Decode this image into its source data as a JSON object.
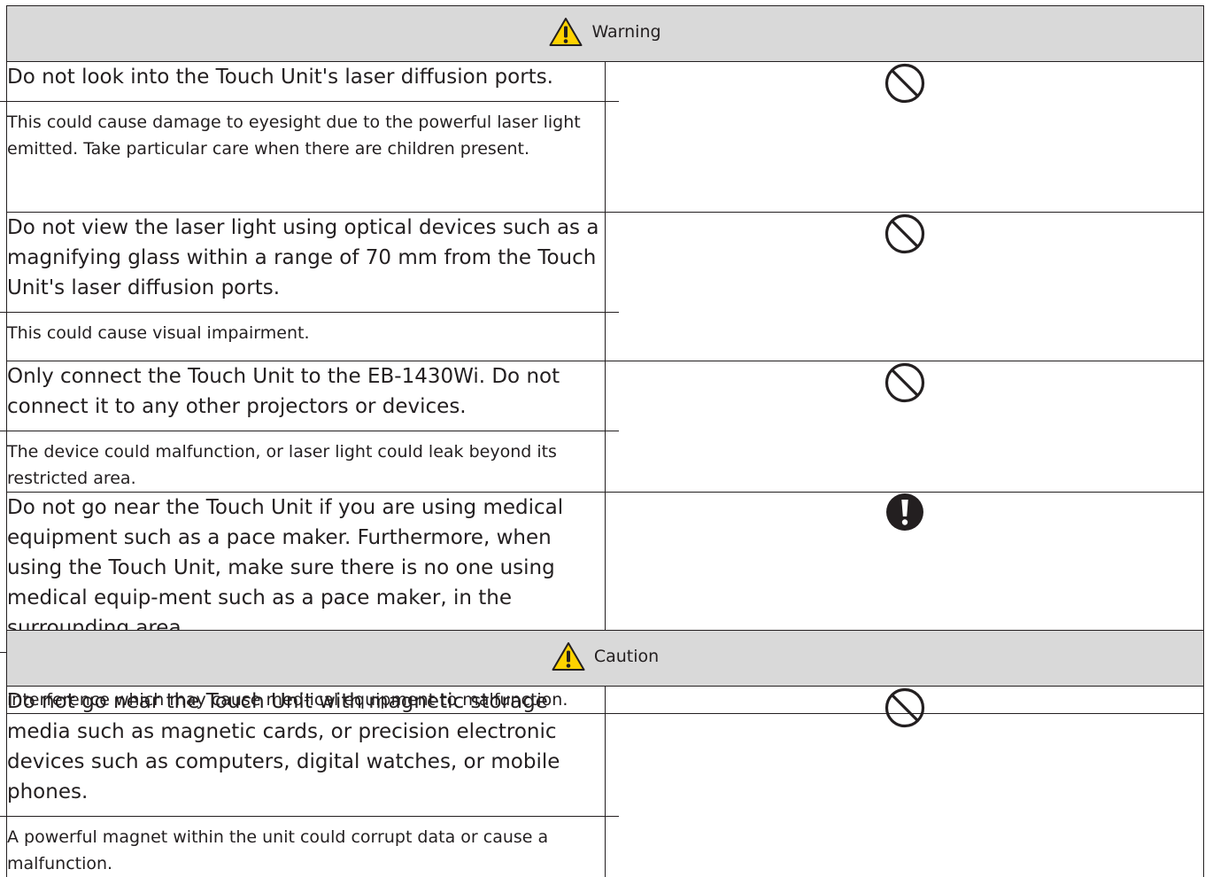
{
  "warning": {
    "title": "Warning",
    "rows": [
      {
        "instruction": "Do not look into the Touch Unit's laser diffusion ports.",
        "explanation": "This could cause damage to eyesight due to the powerful laser light emitted. Take particular care when there are children present.",
        "icon": "prohibition-icon"
      },
      {
        "instruction": "Do not view the laser light using optical devices such as a magnifying glass within a range of 70 mm from the Touch Unit's laser diffusion ports.",
        "explanation": "This could cause visual impairment.",
        "icon": "prohibition-icon"
      },
      {
        "instruction": "Only connect the Touch Unit to the EB-1430Wi. Do not connect it to any other projectors or devices.",
        "explanation": "The device could malfunction, or laser light could leak beyond its restricted area.",
        "icon": "prohibition-icon"
      },
      {
        "instruction": "Do not go near the Touch Unit if you are using medical equipment such as a pace maker. Furthermore, when using the Touch Unit, make sure there is no one using medical equip-ment such as a pace maker, in the surrounding area.",
        "explanation": "A powerful magnet within the unit generates electromagnetic interference which may cause med-ical equipment to malfunction.",
        "icon": "mandatory-action-icon"
      }
    ]
  },
  "caution": {
    "title": "Caution",
    "rows": [
      {
        "instruction": "Do not go near the Touch Unit with magnetic storage media such as magnetic cards, or precision electronic devices such as computers, digital watches, or mobile phones.",
        "explanation": "A powerful magnet within the unit could corrupt data or cause a malfunction.",
        "icon": "prohibition-icon"
      }
    ]
  },
  "colors": {
    "header_background": "#d9d9d9",
    "warning_triangle_fill": "#ffd200",
    "ink": "#231f20"
  }
}
